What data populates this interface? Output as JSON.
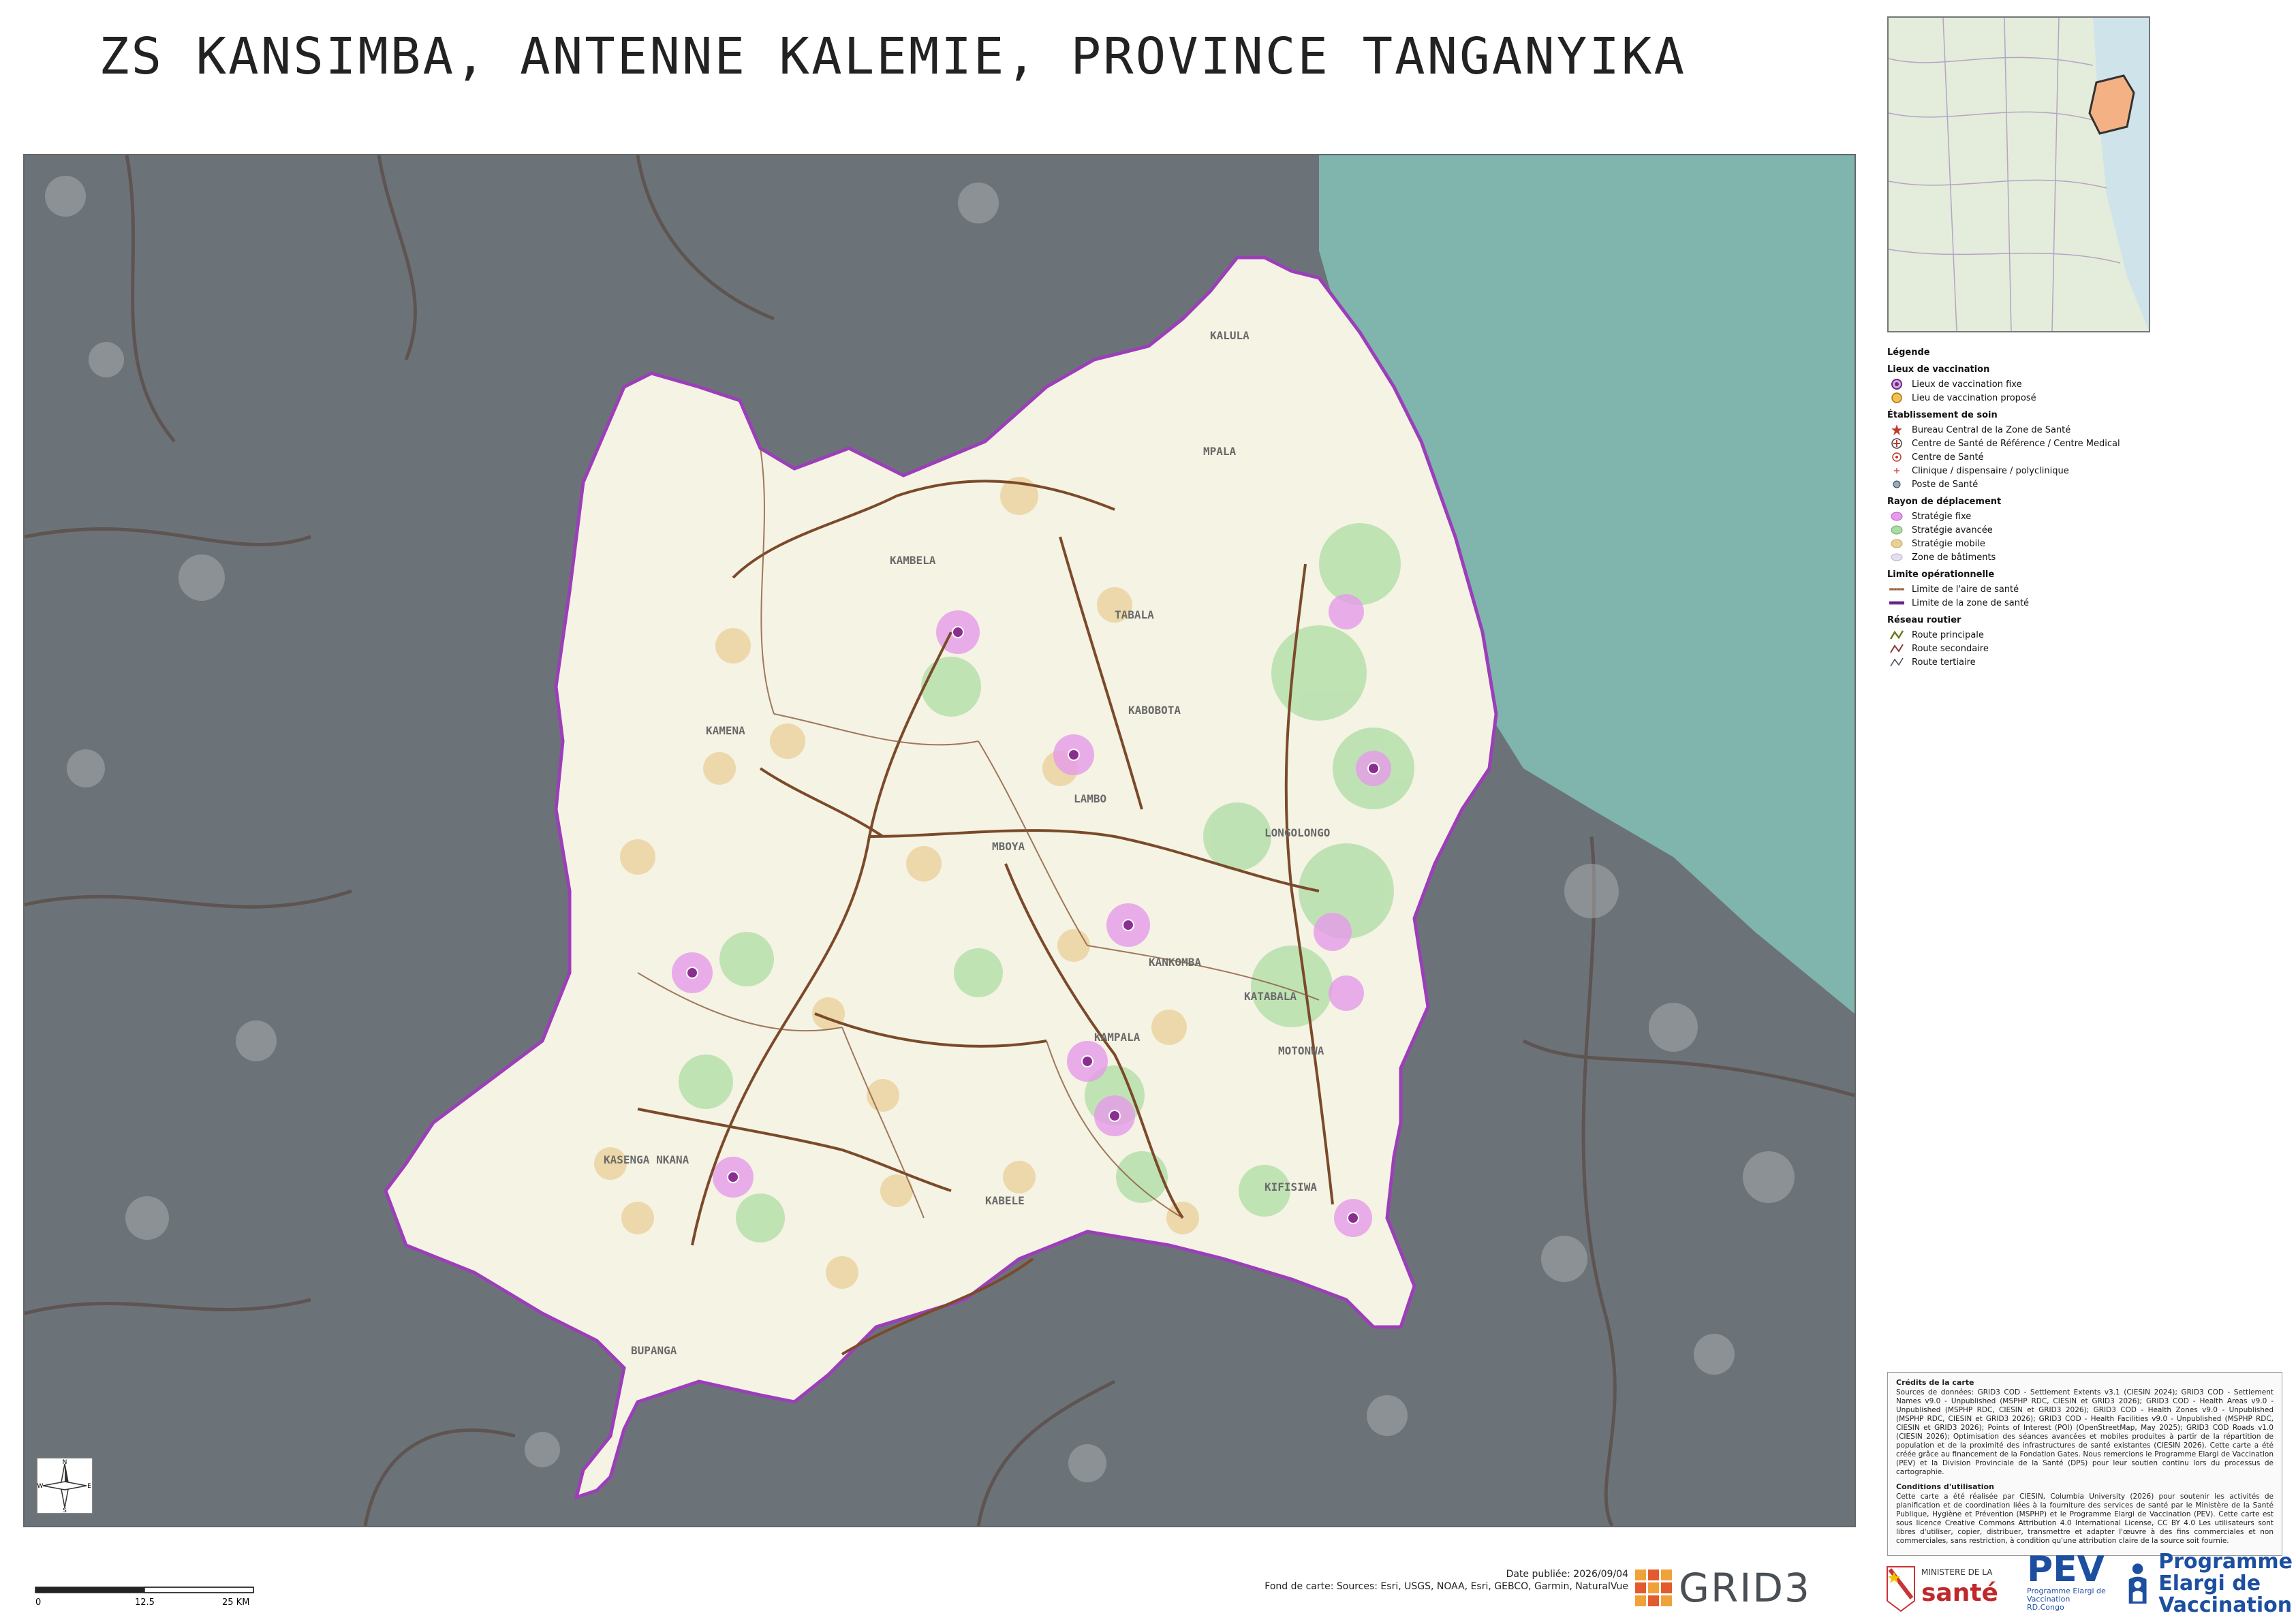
{
  "title": "ZS KANSIMBA, ANTENNE KALEMIE, PROVINCE TANGANYIKA",
  "colors": {
    "zone_fill": "#f5f3e4",
    "outside_fill": "#6c7378",
    "lake": "#7fb5ad",
    "zone_border": "#9b3fb8",
    "fixed_strategy": "#e59be9",
    "advanced_strategy": "#a9dca0",
    "mobile_strategy": "#e9cf98",
    "road_main": "#7b4a2a",
    "road_secondary": "#8a5a3a"
  },
  "map_labels": [
    "KALULA",
    "MPALA",
    "KAMBELA",
    "KAMENA",
    "KABOBOTA",
    "LAMBO",
    "LONGOLONGO",
    "KATABALA",
    "MOTONWA",
    "KAMPALA",
    "KASENGA NKANA",
    "KABELE",
    "KIFISIWA",
    "BUPANGA",
    "TABALA",
    "MBOYA",
    "KANKOMBA"
  ],
  "legend": {
    "title": "Légende",
    "vaccination_title": "Lieux de vaccination",
    "vaccination_items": [
      {
        "label": "Lieux de vaccination fixe",
        "icon": "fixed-vaccination-icon"
      },
      {
        "label": "Lieu de vaccination proposé",
        "icon": "proposed-vaccination-icon"
      }
    ],
    "facility_title": "Établissement de soin",
    "facility_items": [
      {
        "label": "Bureau Central de la Zone de Santé",
        "icon": "star-icon"
      },
      {
        "label": "Centre de Santé de Référence / Centre Medical",
        "icon": "cross-circle-icon"
      },
      {
        "label": "Centre de Santé",
        "icon": "health-center-icon"
      },
      {
        "label": "Clinique / dispensaire / polyclinique",
        "icon": "clinic-icon"
      },
      {
        "label": "Poste de Santé",
        "icon": "health-post-icon"
      }
    ],
    "travel_title": "Rayon de déplacement",
    "travel_items": [
      {
        "label": "Stratégie fixe",
        "icon": "fixed-strategy-swatch"
      },
      {
        "label": "Stratégie avancée",
        "icon": "advanced-strategy-swatch"
      },
      {
        "label": "Stratégie mobile",
        "icon": "mobile-strategy-swatch"
      },
      {
        "label": "Zone de bâtiments",
        "icon": "building-zone-swatch"
      }
    ],
    "boundary_title": "Limite opérationnelle",
    "boundary_items": [
      {
        "label": "Limite de l'aire de santé",
        "icon": "health-area-boundary-line"
      },
      {
        "label": "Limite de la zone de santé",
        "icon": "health-zone-boundary-line"
      }
    ],
    "road_title": "Réseau routier",
    "road_items": [
      {
        "label": "Route principale",
        "icon": "main-road-line"
      },
      {
        "label": "Route secondaire",
        "icon": "secondary-road-line"
      },
      {
        "label": "Route tertiaire",
        "icon": "tertiary-road-line"
      }
    ]
  },
  "credits": {
    "heading": "Crédits de la carte",
    "sources": "Sources de données: GRID3 COD - Settlement Extents v3.1 (CIESIN 2024); GRID3 COD - Settlement Names v9.0 - Unpublished (MSPHP RDC, CIESIN et GRID3 2026); GRID3 COD - Health Areas v9.0 - Unpublished (MSPHP RDC, CIESIN et GRID3 2026); GRID3 COD - Health Zones v9.0 - Unpublished (MSPHP RDC, CIESIN et GRID3 2026); GRID3 COD - Health Facilities v9.0 - Unpublished (MSPHP RDC, CIESIN et GRID3 2026); Points of Interest (POI) (OpenStreetMap, May 2025); GRID3 COD Roads v1.0 (CIESIN 2026); Optimisation des séances avancées et mobiles produites à partir de la répartition de population et de la proximité des infrastructures de santé existantes (CIESIN 2026). Cette carte a été créée grâce au financement de la Fondation Gates. Nous remercions le Programme Elargi de Vaccination (PEV) et la Division Provinciale de la Santé (DPS) pour leur soutien continu lors du processus de cartographie.",
    "conditions_heading": "Conditions d'utilisation",
    "conditions": "Cette carte a été réalisée par CIESIN, Columbia University (2026) pour soutenir les activités de planification et de coordination liées à la fourniture des services de santé par le Ministère de la Santé Publique, Hygiène et Prévention (MSPHP) et le Programme Elargi de Vaccination (PEV). Cette carte est sous licence Creative Commons Attribution 4.0 International License, CC BY 4.0 Les utilisateurs sont libres d'utiliser, copier, distribuer, transmettre et adapter l'œuvre à des fins commerciales et non commerciales, sans restriction, à condition qu'une attribution claire de la source soit fournie."
  },
  "scale": {
    "labels": [
      "0",
      "12.5",
      "25 KM"
    ]
  },
  "north_arrow": {
    "n": "N",
    "s": "S",
    "e": "E",
    "w": "W"
  },
  "publication": {
    "date": "Date publiée: 2026/09/04",
    "basemap": "Fond de carte: Sources: Esri, USGS, NOAA, Esri, GEBCO, Garmin, NaturalVue"
  },
  "logos": {
    "grid3": "GRID3",
    "ministry_small": "MINISTERE DE LA",
    "ministry_big": "santé",
    "pev_big": "PEV",
    "pev_small_1": "Programme Elargi de Vaccination",
    "pev_small_2": "RD.Congo",
    "pev2_line1": "Programme",
    "pev2_line2": "Elargi de",
    "pev2_line3": "Vaccination"
  }
}
